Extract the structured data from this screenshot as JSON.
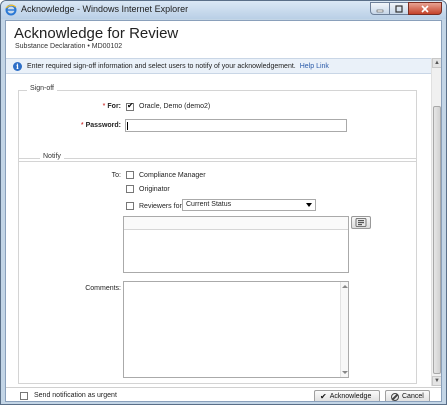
{
  "window": {
    "title": "Acknowledge - Windows Internet Explorer"
  },
  "header": {
    "title": "Acknowledge for Review",
    "subtitle": "Substance Declaration • MD00102"
  },
  "info": {
    "text": "Enter required sign-off information and select users to notify of your acknowledgement.",
    "help_link": "Help Link"
  },
  "signoff": {
    "legend": "Sign-off",
    "required_marker": "*",
    "for_label": "For:",
    "for_value": "Oracle, Demo (demo2)",
    "for_checked": true,
    "password_label": "Password:",
    "password_value": ""
  },
  "notify": {
    "legend": "Notify",
    "to_label": "To:",
    "options": [
      {
        "label": "Compliance Manager",
        "checked": false
      },
      {
        "label": "Originator",
        "checked": false
      },
      {
        "label": "Reviewers for",
        "checked": false
      }
    ],
    "reviewers_select_value": "Current Status",
    "comments_label": "Comments:",
    "comments_value": ""
  },
  "footer": {
    "urgent_label": "Send notification as urgent",
    "urgent_checked": false,
    "acknowledge_label": "Acknowledge",
    "cancel_label": "Cancel"
  },
  "icons": {
    "app": "ie-icon",
    "info": "info-icon",
    "check": "checkmark-icon",
    "address_book": "address-book-icon",
    "cancel": "cancel-icon"
  },
  "colors": {
    "required": "#c00000",
    "link": "#2a5aa8",
    "info_bar": "#eaf1f9",
    "close_button": "#c4422a"
  }
}
